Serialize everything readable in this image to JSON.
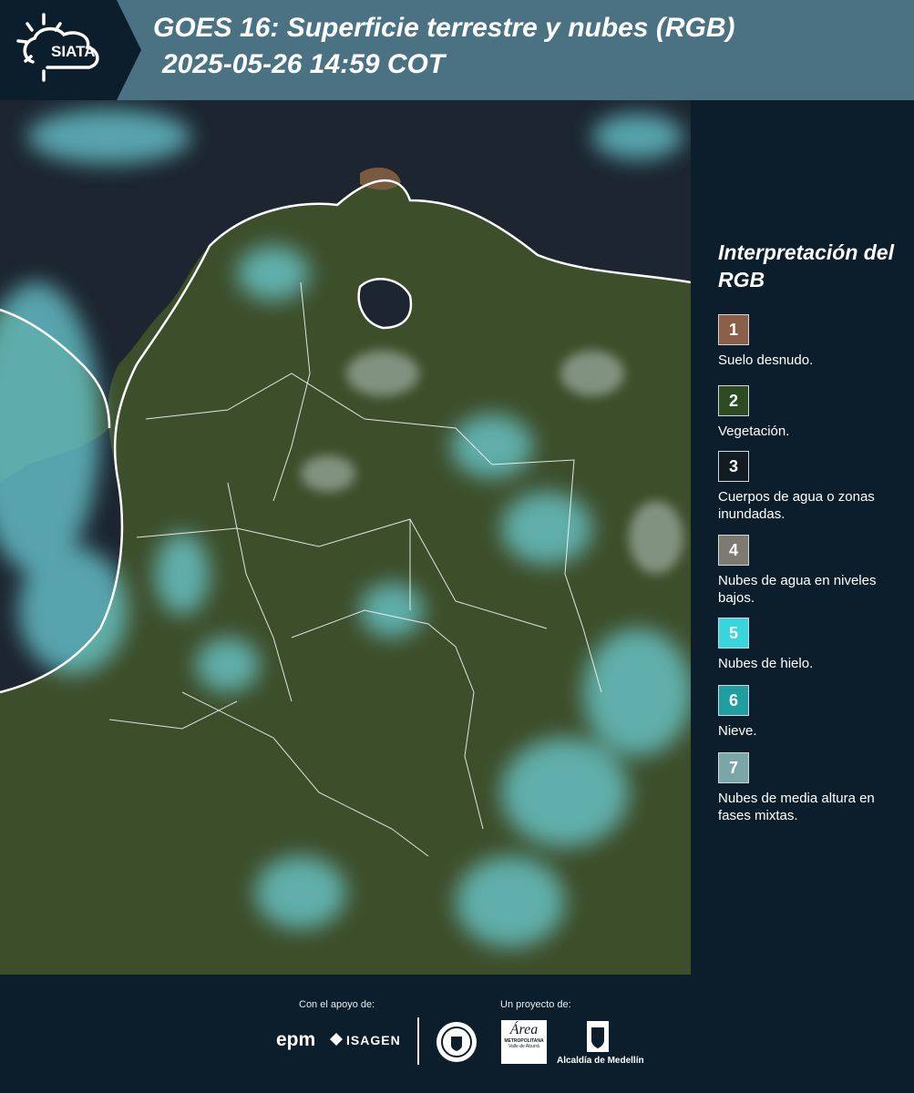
{
  "header": {
    "brand": "SIATA",
    "title_line1": "GOES 16: Superficie terrestre y nubes (RGB)",
    "title_line2": " 2025-05-26 14:59 COT"
  },
  "legend": {
    "title": "Interpretación del RGB",
    "items": [
      {
        "num": "1",
        "label": "Suelo desnudo.",
        "color": "#8a5e48"
      },
      {
        "num": "2",
        "label": "Vegetación.",
        "color": "#2e4a22"
      },
      {
        "num": "3",
        "label": "Cuerpos de agua o zonas inundadas.",
        "color": "#121a22"
      },
      {
        "num": "4",
        "label": "Nubes de agua en niveles bajos.",
        "color": "#7d7a72"
      },
      {
        "num": "5",
        "label": "Nubes de hielo.",
        "color": "#36d6dc"
      },
      {
        "num": "6",
        "label": "Nieve.",
        "color": "#1f9ea2"
      },
      {
        "num": "7",
        "label": "Nubes de media altura en fases mixtas.",
        "color": "#7aa6a8"
      }
    ]
  },
  "footer": {
    "support_label": "Con el apoyo de:",
    "project_label": "Un proyecto de:",
    "epm": "epm",
    "isagen": "ISAGEN",
    "area_metro": "Área",
    "area_metro_sub": "METROPOLITANA",
    "area_metro_sub2": "Valle de Aburrá",
    "alcaldia": "Alcaldía de Medellín"
  },
  "colors": {
    "header_bg": "#4a7282",
    "panel_bg": "#0c1e2b",
    "ocean": "#1c2530",
    "land": "#3d4e2a",
    "cloud": "#6ccfd6"
  }
}
